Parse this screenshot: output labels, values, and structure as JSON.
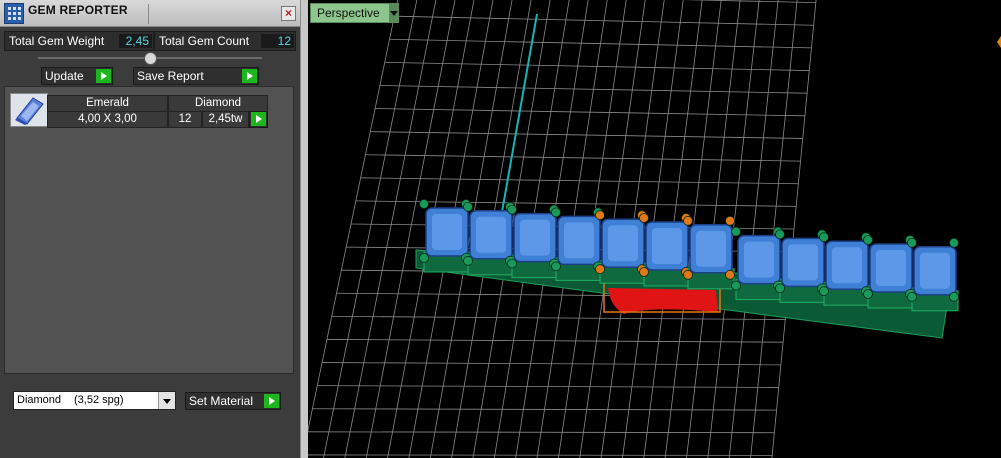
{
  "panel": {
    "title": "GEM REPORTER",
    "close_glyph": "×",
    "total_weight_label": "Total Gem Weight",
    "total_weight_value": "2,45",
    "total_count_label": "Total Gem Count",
    "total_count_value": "12",
    "update_label": "Update",
    "save_report_label": "Save Report"
  },
  "gem_table": {
    "headers": [
      "Emerald",
      "Diamond"
    ],
    "rows": [
      {
        "size": "4,00 X 3,00",
        "count": "12",
        "weight": "2,45tw"
      }
    ]
  },
  "material": {
    "selected": "Diamond",
    "spg": "(3,52 spg)",
    "set_label": "Set Material"
  },
  "viewport": {
    "label": "Perspective"
  },
  "icons": {
    "app": "gem-reporter-icon",
    "close": "close-icon",
    "play": "play-arrow-icon",
    "dropdown": "chevron-down-icon",
    "gem": "emerald-gem-icon"
  },
  "colors": {
    "panel_bg": "#3c3c3c",
    "value_text": "#59d6e6",
    "play_green": "#1db61d",
    "viewport_label_bg": "#8dc68d",
    "grid": "#8a8a8a",
    "gem_blue": "#3f7fd6",
    "selected_orange": "#e07818",
    "prong_green": "#1a9a5a",
    "axis_cyan": "#19b5b5"
  }
}
